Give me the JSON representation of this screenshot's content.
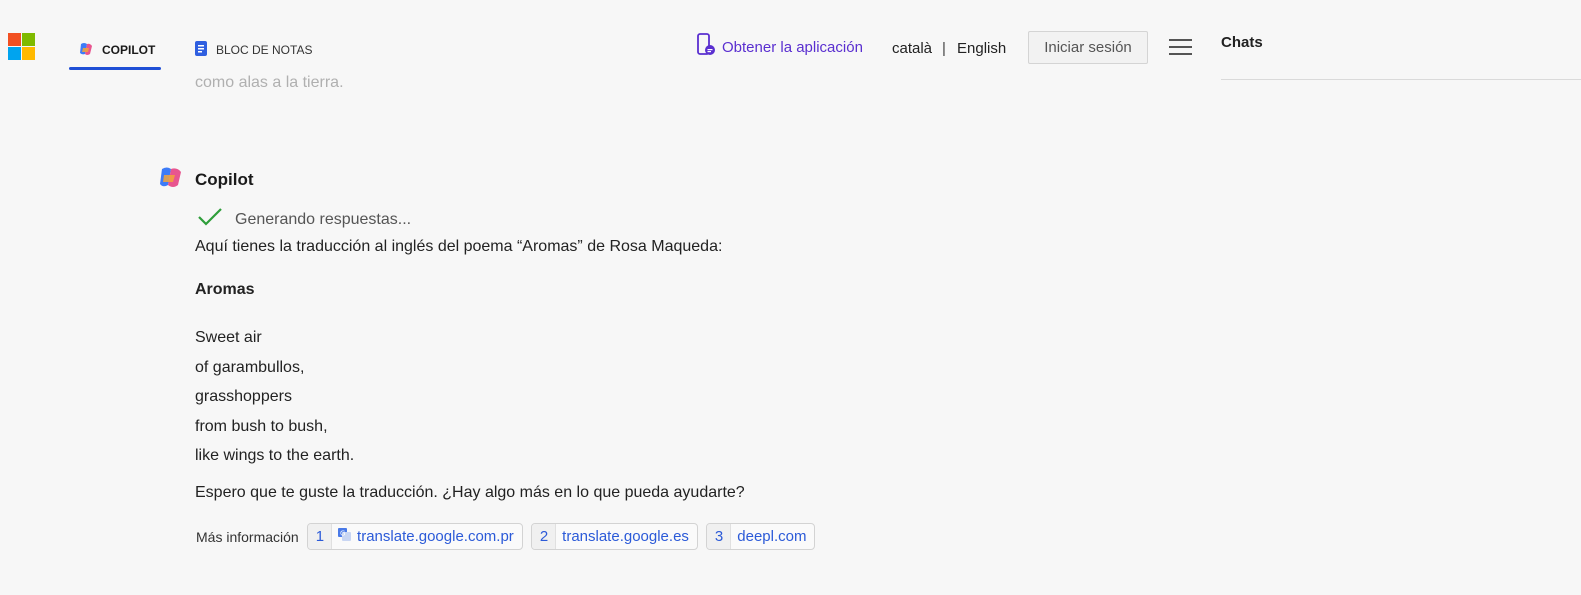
{
  "header": {
    "tabs": [
      {
        "label": "COPILOT",
        "icon": "copilot-icon",
        "active": true
      },
      {
        "label": "BLOC DE NOTAS",
        "icon": "notebook-icon",
        "active": false
      }
    ],
    "get_app": "Obtener la aplicación",
    "languages": [
      "català",
      "English"
    ],
    "lang_separator": "|",
    "signin_label": "Iniciar sesión",
    "menu_icon": "hamburger-icon"
  },
  "sidebar": {
    "title": "Chats"
  },
  "conversation": {
    "previous_tail": "como alas a la tierra.",
    "author": "Copilot",
    "status": "Generando respuestas...",
    "intro": "Aquí tienes la traducción al inglés del poema “Aromas” de Rosa Maqueda:",
    "poem_title": "Aromas",
    "poem_lines": [
      "Sweet air",
      "of garambullos,",
      "grasshoppers",
      "from bush to bush,",
      "like wings to the earth."
    ],
    "closing": "Espero que te guste la traducción. ¿Hay algo más en lo que pueda ayudarte?",
    "more_info_label": "Más información",
    "citations": [
      {
        "num": "1",
        "domain": "translate.google.com.pr",
        "icon": "google-translate-icon"
      },
      {
        "num": "2",
        "domain": "translate.google.es"
      },
      {
        "num": "3",
        "domain": "deepl.com"
      }
    ]
  },
  "colors": {
    "accent": "#1f4fd6",
    "link": "#2b5ad8",
    "app_link": "#5a2fd0",
    "check": "#2e9e3a"
  }
}
